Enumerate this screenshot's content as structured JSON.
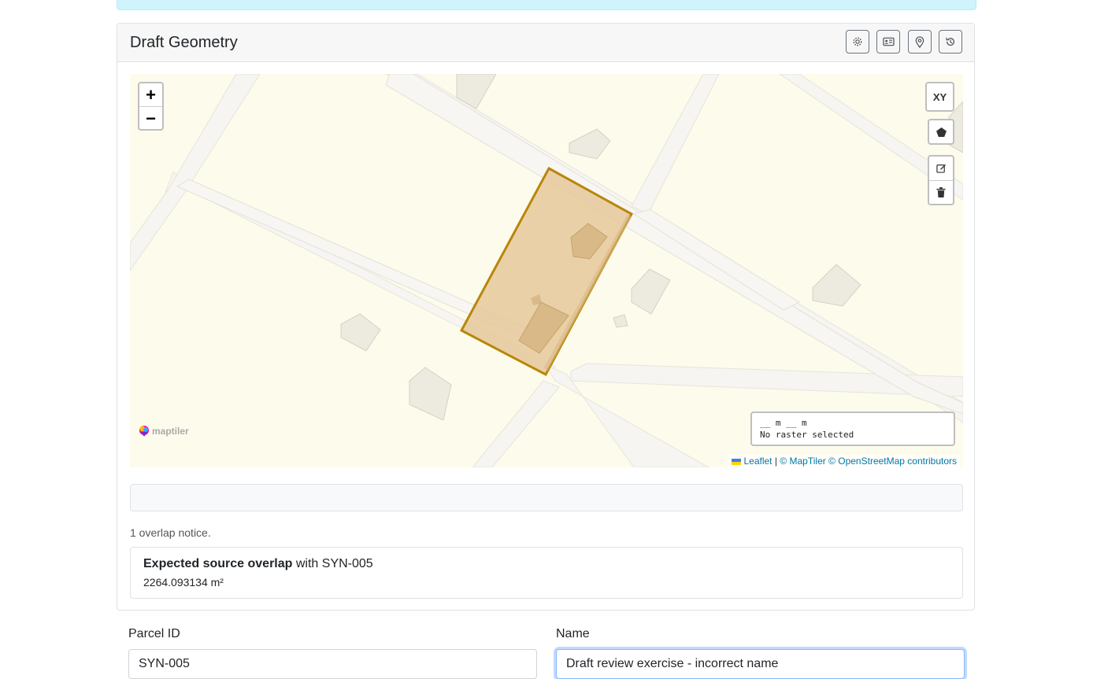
{
  "card": {
    "title": "Draft Geometry",
    "header_buttons": [
      {
        "icon": "gear-icon"
      },
      {
        "icon": "id-card-icon"
      },
      {
        "icon": "map-pin-icon"
      },
      {
        "icon": "history-icon"
      }
    ]
  },
  "map": {
    "zoom_in": "+",
    "zoom_out": "−",
    "xy_label": "XY",
    "scale_text": "__ m __ m",
    "raster_text": "No raster selected",
    "maptiler_logo": "maptiler",
    "attribution": {
      "leaflet": "Leaflet",
      "separator": "|",
      "maptiler": "© MapTiler",
      "osm": "© OpenStreetMap contributors"
    },
    "colors": {
      "background": "#fdfbeb",
      "roads": "#f7f6f3",
      "buildings": "#edeae0",
      "parcel_fill": "#e6c89a",
      "parcel_stroke": "#b8860b"
    }
  },
  "overlaps": {
    "count_text": "1 overlap notice.",
    "items": [
      {
        "title": "Expected source overlap",
        "with_text": "with SYN-005",
        "area": "2264.093134 m²"
      }
    ]
  },
  "form": {
    "parcel_id_label": "Parcel ID",
    "parcel_id_value": "SYN-005",
    "name_label": "Name",
    "name_value": "Draft review exercise - incorrect name"
  }
}
